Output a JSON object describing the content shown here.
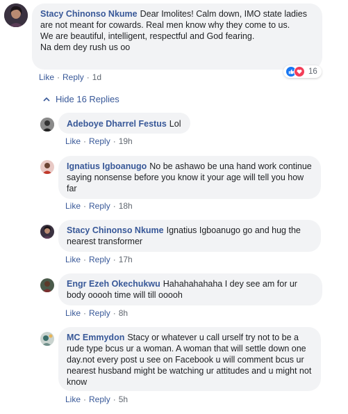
{
  "main_comment": {
    "author": "Stacy Chinonso Nkume",
    "text": "Dear Imolites! Calm down, IMO state ladies are not meant for cowards. Real men know why they come to us.\nWe are beautiful, intelligent, respectful and God fearing.\nNa dem dey rush us oo",
    "like_label": "Like",
    "reply_label": "Reply",
    "time": "1d",
    "reaction_count": "16",
    "reaction_icons": [
      "thumbs-up-icon",
      "heart-icon"
    ]
  },
  "hide_replies": {
    "label": "Hide 16 Replies"
  },
  "replies": [
    {
      "author": "Adeboye Dharrel Festus",
      "text": "Lol",
      "like_label": "Like",
      "reply_label": "Reply",
      "time": "19h"
    },
    {
      "author": "Ignatius Igboanugo",
      "text": "No be ashawo be una hand work continue saying nonsense before you know it your age will tell you how far",
      "like_label": "Like",
      "reply_label": "Reply",
      "time": "18h"
    },
    {
      "author": "Stacy Chinonso Nkume",
      "text": "Ignatius Igboanugo go and hug the nearest transformer",
      "like_label": "Like",
      "reply_label": "Reply",
      "time": "17h"
    },
    {
      "author": "Engr Ezeh Okechukwu",
      "text": "Hahahahahaha I dey see am for ur body ooooh time will till ooooh",
      "like_label": "Like",
      "reply_label": "Reply",
      "time": "8h"
    },
    {
      "author": "MC Emmydon",
      "text": "Stacy or whatever u call urself try not to be a rude type bcus ur a woman. A woman that will settle down one day.not every post u see on Facebook u will comment bcus ur nearest husband might be watching ur attitudes and u might not know",
      "like_label": "Like",
      "reply_label": "Reply",
      "time": "5h"
    }
  ],
  "colors": {
    "link": "#385898",
    "bubble": "#f2f3f5",
    "meta": "#606770",
    "like_blue": "#1877f2",
    "heart_red": "#f33e58"
  }
}
